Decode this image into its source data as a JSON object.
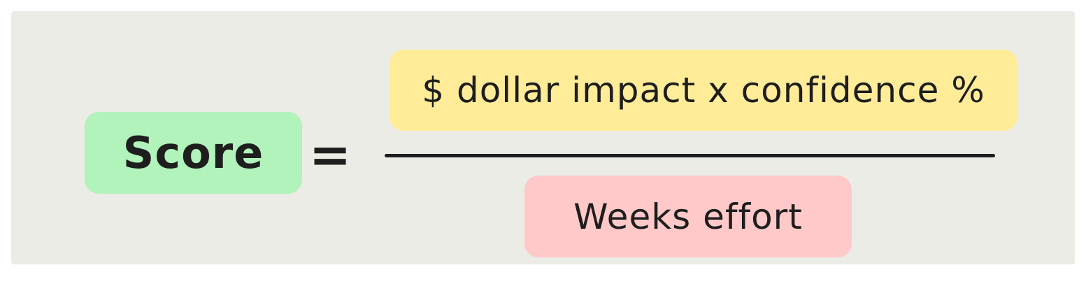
{
  "formula": {
    "lhs_label": "Score",
    "operator": "=",
    "numerator_label": "$ dollar impact x confidence %",
    "denominator_label": "Weeks effort"
  },
  "colors": {
    "canvas_background": "#ecece6",
    "score_fill": "#b2f2bb",
    "numerator_fill": "#ffec99",
    "denominator_fill": "#ffc9c9",
    "ink": "#1e1e1e"
  }
}
